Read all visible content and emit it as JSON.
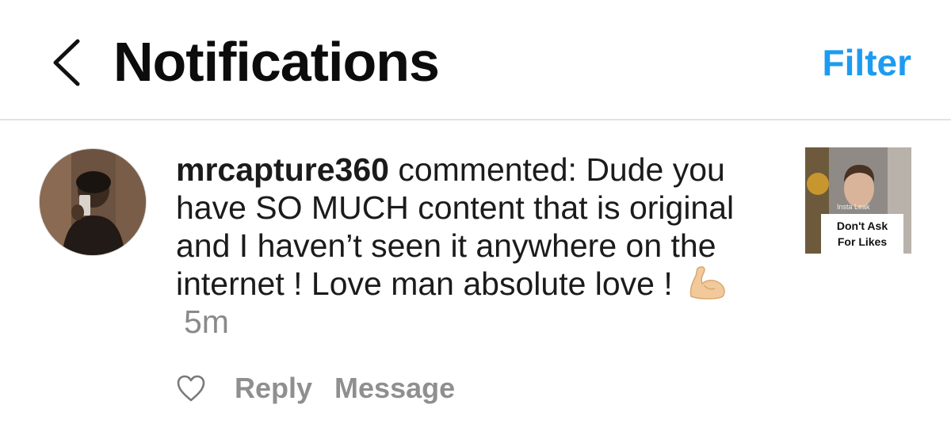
{
  "header": {
    "title": "Notifications",
    "filter_label": "Filter",
    "back_icon": "chevron-left-icon"
  },
  "notification": {
    "username": "mrcapture360",
    "comment_text": " commented: Dude you have SO MUCH content that is original and I haven’t seen it anywhere on the internet ! Love man absolute love ! ",
    "emoji": "flexed-biceps-emoji",
    "time": "5m",
    "actions": {
      "like_icon": "heart-icon",
      "reply_label": "Reply",
      "message_label": "Message"
    },
    "thumbnail": {
      "caption_line1": "Don't Ask",
      "caption_line2": "For Likes",
      "watermark": "Insta Leak"
    }
  },
  "colors": {
    "accent": "#1e9bf0",
    "secondary_text": "#8f8f8f",
    "divider": "#e2e2e2"
  }
}
